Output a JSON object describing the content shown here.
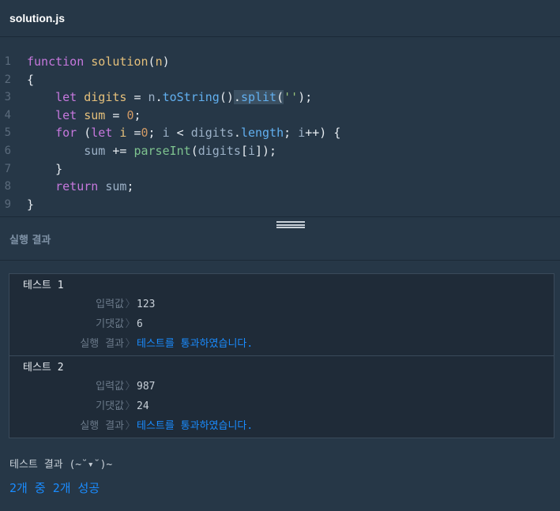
{
  "file": {
    "name": "solution.js"
  },
  "editor": {
    "line_numbers": [
      "1",
      "2",
      "3",
      "4",
      "5",
      "6",
      "7",
      "8",
      "9"
    ]
  },
  "results": {
    "header": "실행 결과",
    "tests": [
      {
        "title": "테스트 1",
        "input_label": "입력값",
        "input": "123",
        "expected_label": "기댓값",
        "expected": "6",
        "result_label": "실행 결과",
        "result": "테스트를 통과하였습니다."
      },
      {
        "title": "테스트 2",
        "input_label": "입력값",
        "input": "987",
        "expected_label": "기댓값",
        "expected": "24",
        "result_label": "실행 결과",
        "result": "테스트를 통과하였습니다."
      }
    ],
    "separator": "〉",
    "summary_title": "테스트 결과 (~˘▾˘)~",
    "summary_result": "2개 중 2개 성공"
  },
  "colors": {
    "background": "#263747",
    "pass": "#1a8cff"
  }
}
